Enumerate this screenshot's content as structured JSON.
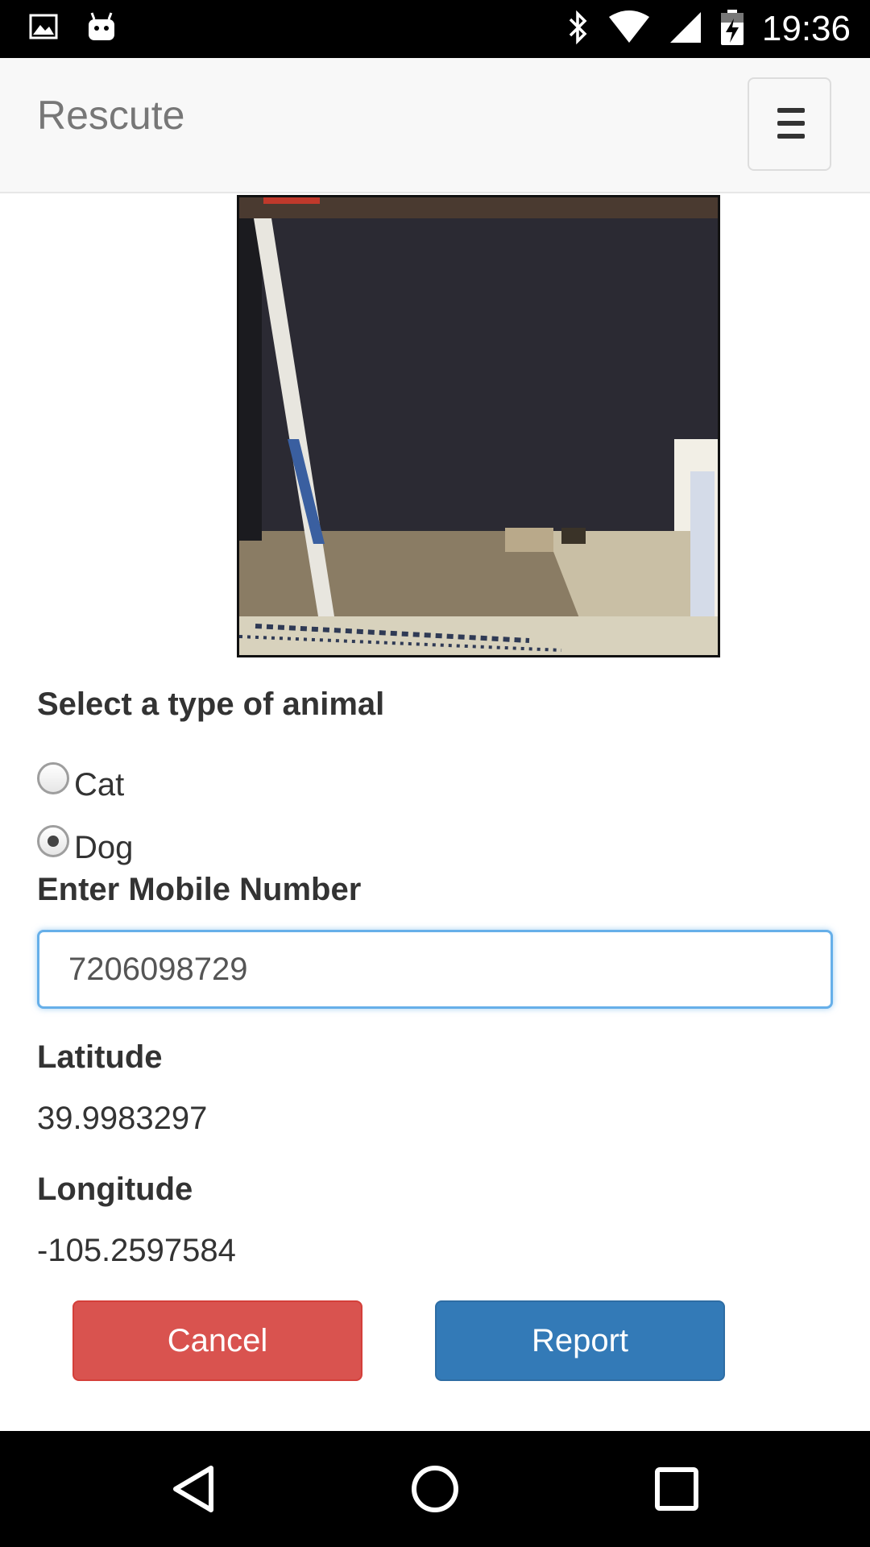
{
  "status_bar": {
    "time": "19:36",
    "icons": [
      "image-notification-icon",
      "android-notification-icon",
      "bluetooth-icon",
      "wifi-icon",
      "cell-signal-icon",
      "battery-charging-icon"
    ]
  },
  "navbar": {
    "brand": "Rescute",
    "menu_icon": "hamburger-icon"
  },
  "form": {
    "animal_type_label": "Select a type of animal",
    "animal_options": [
      {
        "label": "Cat",
        "checked": false
      },
      {
        "label": "Dog",
        "checked": true
      }
    ],
    "mobile_label": "Enter Mobile Number",
    "mobile_value": "7206098729",
    "latitude_label": "Latitude",
    "latitude_value": "39.9983297",
    "longitude_label": "Longitude",
    "longitude_value": "-105.2597584"
  },
  "buttons": {
    "cancel": "Cancel",
    "report": "Report"
  },
  "colors": {
    "cancel": "#d9534f",
    "report": "#337ab7",
    "input_focus": "#66afe9"
  },
  "system_nav": [
    "back-icon",
    "home-icon",
    "recents-icon"
  ]
}
